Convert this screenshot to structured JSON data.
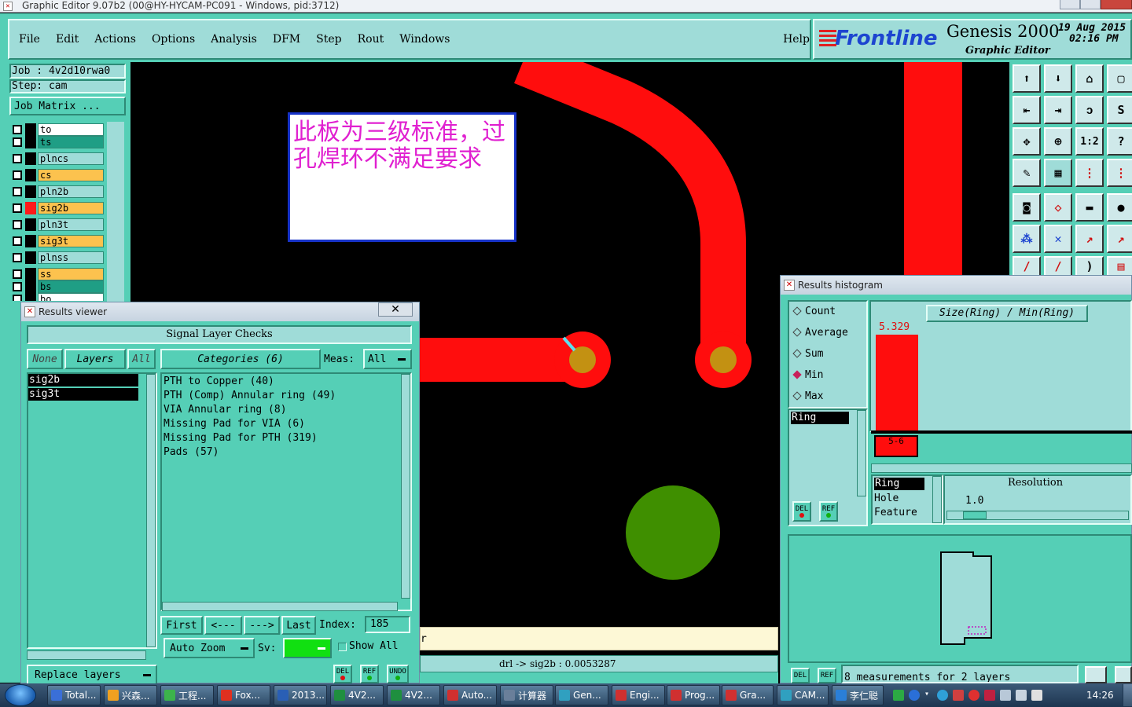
{
  "window": {
    "title": "Graphic Editor 9.07b2 (00@HY-HYCAM-PC091 - Windows, pid:3712)"
  },
  "menu": {
    "items": [
      "File",
      "Edit",
      "Actions",
      "Options",
      "Analysis",
      "DFM",
      "Step",
      "Rout",
      "Windows"
    ],
    "help": "Help"
  },
  "brand": {
    "logo": "Frontline",
    "product": "Genesis 2000",
    "subtitle": "Graphic Editor",
    "date": "19 Aug 2015",
    "time": "02:16 PM"
  },
  "job": {
    "job_line": "Job : 4v2d10rwa0",
    "step_line": "Step: cam",
    "matrix_button": "Job Matrix ..."
  },
  "layers": [
    {
      "name": "to",
      "color": "#ffffff",
      "swatch": "#000000"
    },
    {
      "name": "ts",
      "color": "#1f9e85",
      "swatch": "#000000"
    },
    {
      "name": "plncs",
      "color": "#9fdcd8",
      "swatch": "#000000"
    },
    {
      "name": "cs",
      "color": "#fcc24e",
      "swatch": "#000000"
    },
    {
      "name": "pln2b",
      "color": "#9fdcd8",
      "swatch": "#000000"
    },
    {
      "name": "sig2b",
      "color": "#fcc24e",
      "swatch": "#ff1a1a"
    },
    {
      "name": "pln3t",
      "color": "#9fdcd8",
      "swatch": "#000000"
    },
    {
      "name": "sig3t",
      "color": "#fcc24e",
      "swatch": "#000000"
    },
    {
      "name": "plnss",
      "color": "#9fdcd8",
      "swatch": "#000000"
    },
    {
      "name": "ss",
      "color": "#fcc24e",
      "swatch": "#000000"
    },
    {
      "name": "bs",
      "color": "#1f9e85",
      "swatch": "#000000"
    },
    {
      "name": "bo",
      "color": "#ffffff",
      "swatch": "#000000"
    }
  ],
  "note": {
    "text": "此板为三级标准，过孔焊环不满足要求"
  },
  "results_viewer": {
    "title": "Results viewer",
    "header": "Signal Layer Checks",
    "btn_none": "None",
    "btn_layers": "Layers",
    "btn_all": "All",
    "categories_label": "Categories (6)",
    "meas_label": "Meas:",
    "meas_value": "All",
    "layers_list": [
      "sig2b",
      "sig3t"
    ],
    "categories": [
      "PTH to Copper (40)",
      "PTH (Comp) Annular ring (49)",
      "VIA Annular ring (8)",
      "Missing Pad for VIA (6)",
      "Missing Pad for PTH (319)",
      "Pads (57)"
    ],
    "nav": {
      "first": "First",
      "prev": "<---",
      "next": "--->",
      "last": "Last",
      "index_label": "Index:",
      "index_value": "185"
    },
    "auto_zoom": "Auto Zoom",
    "sv_label": "Sv:",
    "show_all": "Show All",
    "replace_layers": "Replace layers",
    "del": "DEL",
    "ref": "REF",
    "undo": "UNDO"
  },
  "status": {
    "text": "drl -> sig2b : 0.0053287",
    "r_text": "r"
  },
  "histogram": {
    "title": "Results histogram",
    "options": [
      "Count",
      "Average",
      "Sum",
      "Min",
      "Max"
    ],
    "selected": "Min",
    "chart_title": "Size(Ring) / Min(Ring)",
    "bar_value": "5.329",
    "bar_bin": "5-6",
    "ring_list": [
      "Ring"
    ],
    "type_list": [
      "Ring",
      "Hole",
      "Feature"
    ],
    "resolution_label": "Resolution",
    "resolution_value": "1.0",
    "footer": "8 measurements for 2 layers",
    "del": "DEL",
    "ref": "REF"
  },
  "chart_data": {
    "type": "bar",
    "title": "Size(Ring) / Min(Ring)",
    "categories": [
      "5-6"
    ],
    "values": [
      5.329
    ]
  },
  "taskbar": {
    "items": [
      {
        "label": "Total...",
        "color": "#3a6fd8"
      },
      {
        "label": "兴森...",
        "color": "#f0a020"
      },
      {
        "label": "工程...",
        "color": "#3cb44b"
      },
      {
        "label": "Fox...",
        "color": "#e03020"
      },
      {
        "label": "2013...",
        "color": "#2a5fb5"
      },
      {
        "label": "4V2...",
        "color": "#1f8f3f"
      },
      {
        "label": "4V2...",
        "color": "#1f8f3f"
      },
      {
        "label": "Auto...",
        "color": "#d03030"
      },
      {
        "label": "计算器",
        "color": "#6a7f9a"
      },
      {
        "label": "Gen...",
        "color": "#30a0c0"
      },
      {
        "label": "Engi...",
        "color": "#d03030"
      },
      {
        "label": "Prog...",
        "color": "#d03030"
      },
      {
        "label": "Gra...",
        "color": "#d03030"
      },
      {
        "label": "CAM...",
        "color": "#30a0c0"
      },
      {
        "label": "李仁聪",
        "color": "#2a7fd8"
      }
    ],
    "clock": "14:26"
  }
}
